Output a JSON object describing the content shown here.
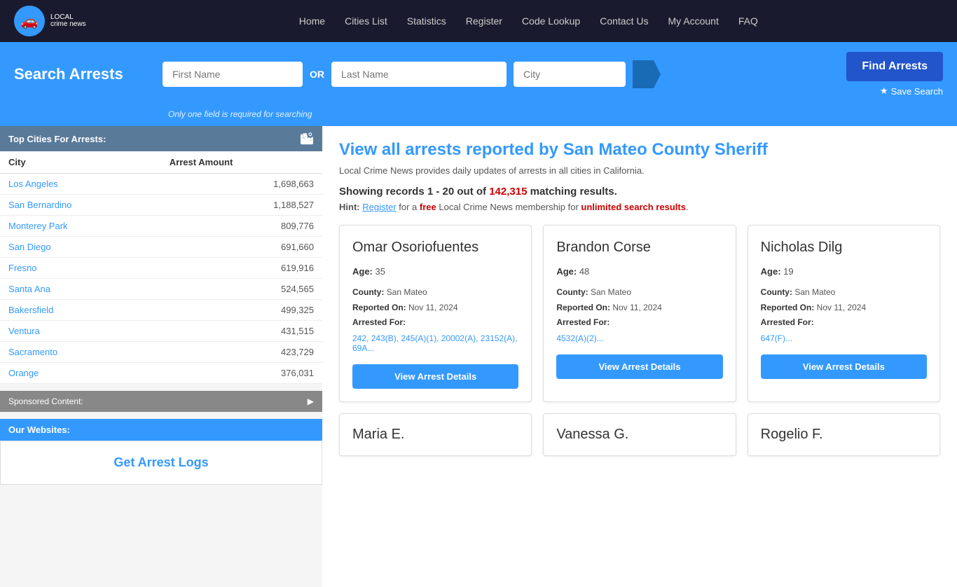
{
  "nav": {
    "logo_text": "crime news",
    "logo_sub": "LOCAL",
    "links": [
      {
        "label": "Home",
        "name": "nav-home"
      },
      {
        "label": "Cities List",
        "name": "nav-cities-list"
      },
      {
        "label": "Statistics",
        "name": "nav-statistics"
      },
      {
        "label": "Register",
        "name": "nav-register"
      },
      {
        "label": "Code Lookup",
        "name": "nav-code-lookup"
      },
      {
        "label": "Contact Us",
        "name": "nav-contact-us"
      },
      {
        "label": "My Account",
        "name": "nav-my-account"
      },
      {
        "label": "FAQ",
        "name": "nav-faq"
      }
    ]
  },
  "search": {
    "title": "Search Arrests",
    "first_name_placeholder": "First Name",
    "or_label": "OR",
    "last_name_placeholder": "Last Name",
    "city_placeholder": "City",
    "hint": "Only one field is required for searching",
    "find_button": "Find Arrests",
    "save_search": "Save Search"
  },
  "sidebar": {
    "top_cities_title": "Top Cities For Arrests:",
    "columns": {
      "city": "City",
      "arrest_amount": "Arrest Amount"
    },
    "cities": [
      {
        "name": "Los Angeles",
        "amount": "1,698,663"
      },
      {
        "name": "San Bernardino",
        "amount": "1,188,527"
      },
      {
        "name": "Monterey Park",
        "amount": "809,776"
      },
      {
        "name": "San Diego",
        "amount": "691,660"
      },
      {
        "name": "Fresno",
        "amount": "619,916"
      },
      {
        "name": "Santa Ana",
        "amount": "524,565"
      },
      {
        "name": "Bakersfield",
        "amount": "499,325"
      },
      {
        "name": "Ventura",
        "amount": "431,515"
      },
      {
        "name": "Sacramento",
        "amount": "423,729"
      },
      {
        "name": "Orange",
        "amount": "376,031"
      }
    ],
    "sponsored_label": "Sponsored Content:",
    "our_websites_label": "Our Websites:",
    "get_arrest_logs_title": "Get Arrest Logs"
  },
  "content": {
    "title": "View all arrests reported by San Mateo County Sheriff",
    "subtitle": "Local Crime News provides daily updates of arrests in all cities in California.",
    "showing_prefix": "Showing records ",
    "showing_range": "1 - 20",
    "showing_middle": " out of ",
    "total": "142,315",
    "showing_suffix": " matching results.",
    "hint_prefix": "Hint: ",
    "hint_register": "Register",
    "hint_middle": " for a ",
    "hint_free": "free",
    "hint_text": " Local Crime News membership for ",
    "hint_unlimited": "unlimited search results",
    "hint_end": ".",
    "cards": [
      {
        "name": "Omar Osoriofuentes",
        "age": "35",
        "county": "San Mateo",
        "reported_on": "Nov 11, 2024",
        "arrested_for_label": "Arrested For:",
        "codes": "242, 243(B), 245(A)(1), 20002(A), 23152(A), 69A...",
        "view_button": "View Arrest Details"
      },
      {
        "name": "Brandon Corse",
        "age": "48",
        "county": "San Mateo",
        "reported_on": "Nov 11, 2024",
        "arrested_for_label": "Arrested For:",
        "codes": "4532(A)(2)...",
        "view_button": "View Arrest Details"
      },
      {
        "name": "Nicholas Dilg",
        "age": "19",
        "county": "San Mateo",
        "reported_on": "Nov 11, 2024",
        "arrested_for_label": "Arrested For:",
        "codes": "647(F)...",
        "view_button": "View Arrest Details"
      }
    ],
    "bottom_cards": [
      {
        "name": "Maria E."
      },
      {
        "name": "Vanessa G."
      },
      {
        "name": "Rogelio F."
      }
    ]
  }
}
